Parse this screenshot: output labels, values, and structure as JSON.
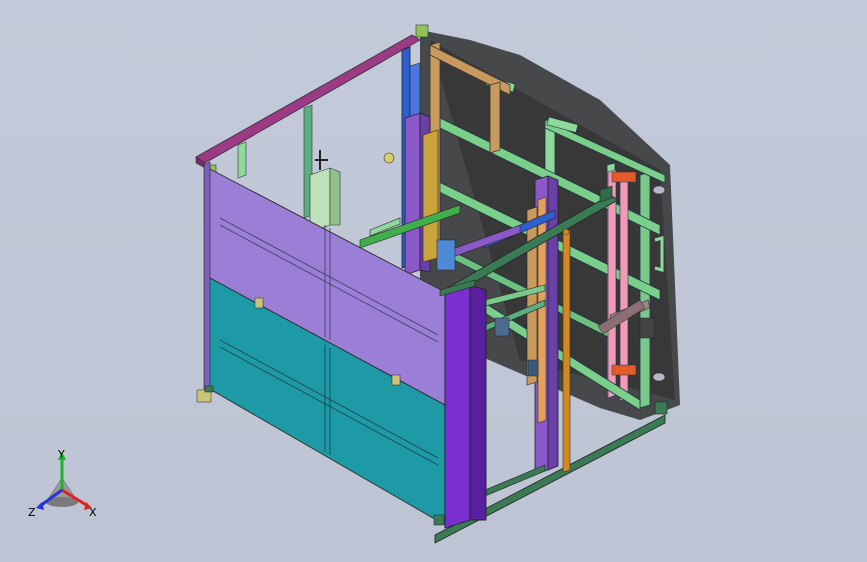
{
  "viewport": {
    "background_color": "#c3cad9",
    "view_mode": "shaded-with-edges",
    "projection": "isometric"
  },
  "model": {
    "description_icon": "machine-frame-assembly-icon",
    "colors": {
      "panel_purple": "#9b7fd6",
      "panel_teal": "#1e9aa6",
      "frame_magenta": "#9c3a86",
      "frame_green": "#3a7a55",
      "frame_lightgreen": "#8fd99a",
      "frame_tan": "#c99a5d",
      "frame_blue": "#2f5fcf",
      "frame_violet": "#7c2fd0",
      "accent_red": "#e45b2a",
      "accent_orange": "#d7861b",
      "accent_pink": "#f09ab8",
      "shadow": "#3b3b3b"
    }
  },
  "triad": {
    "x_label": "X",
    "y_label": "Y",
    "z_label": "Z",
    "x_color": "#e0221c",
    "y_color": "#1fb427",
    "z_color": "#2434d6"
  }
}
